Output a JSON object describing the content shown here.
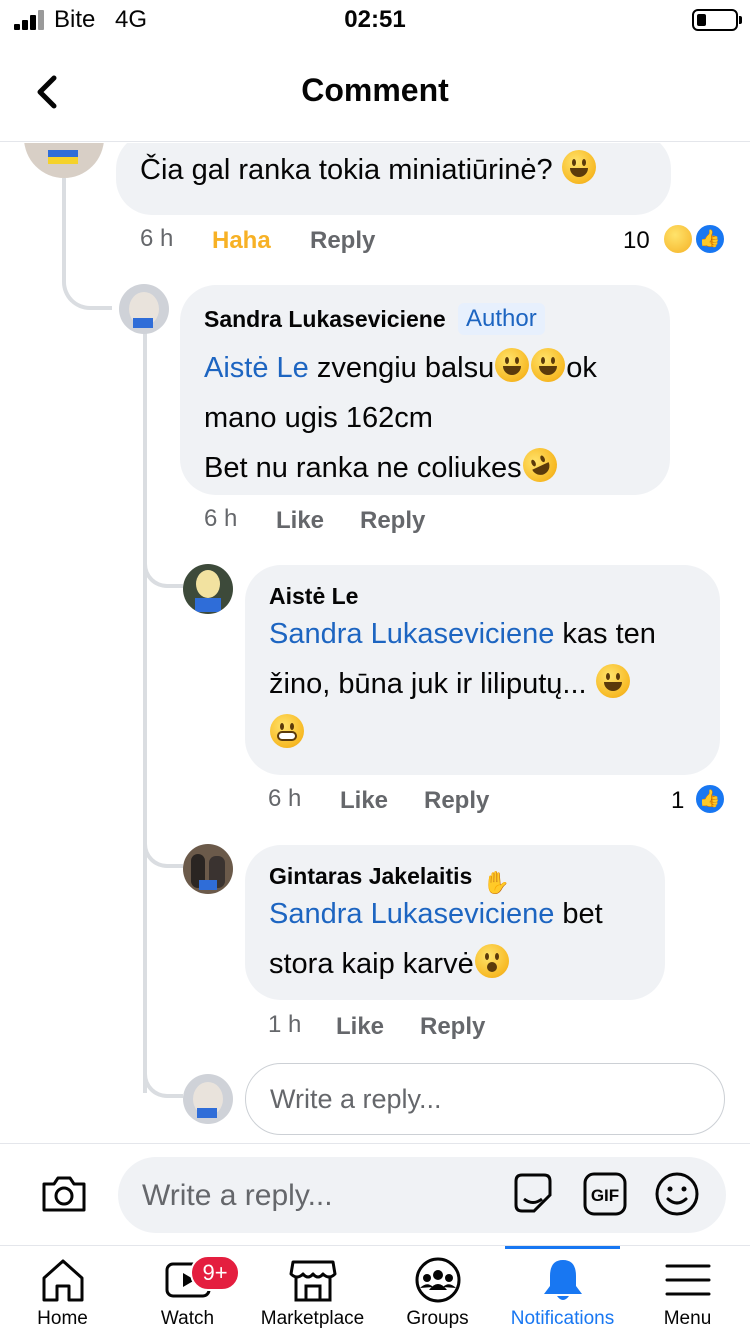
{
  "status_bar": {
    "carrier": "Bite",
    "network": "4G",
    "time": "02:51"
  },
  "header": {
    "title": "Comment"
  },
  "comments": [
    {
      "text": "Čia gal ranka tokia miniatiūrinė?",
      "time": "6 h",
      "reaction_label": "Haha",
      "reply_label": "Reply",
      "reaction_count": "10"
    },
    {
      "author": "Sandra Lukaseviciene",
      "badge": "Author",
      "mention": "Aistė Le",
      "line1": " zvengiu balsu",
      "line1_tail": "ok",
      "line2": "mano ugis 162cm",
      "line3": "Bet nu ranka ne coliukes",
      "time": "6 h",
      "like_label": "Like",
      "reply_label": "Reply"
    },
    {
      "author": "Aistė Le",
      "mention": "Sandra Lukaseviciene",
      "line1": " kas ten",
      "line2": "žino, būna juk ir liliputų...",
      "time": "6 h",
      "like_label": "Like",
      "reply_label": "Reply",
      "reaction_count": "1"
    },
    {
      "author": "Gintaras Jakelaitis",
      "mention": "Sandra Lukaseviciene",
      "line1": " bet",
      "line2": "stora kaip karvė",
      "time": "1 h",
      "like_label": "Like",
      "reply_label": "Reply"
    }
  ],
  "thread_reply": {
    "placeholder": "Write a reply..."
  },
  "compose": {
    "placeholder": "Write a reply...",
    "gif_label": "GIF"
  },
  "tabbar": {
    "tabs": [
      {
        "label": "Home",
        "icon": "home-icon"
      },
      {
        "label": "Watch",
        "icon": "watch-icon",
        "badge": "9+"
      },
      {
        "label": "Marketplace",
        "icon": "marketplace-icon"
      },
      {
        "label": "Groups",
        "icon": "groups-icon"
      },
      {
        "label": "Notifications",
        "icon": "bell-icon",
        "active": true
      },
      {
        "label": "Menu",
        "icon": "menu-icon"
      }
    ]
  },
  "colors": {
    "accent": "#1877f2",
    "mention": "#1d65c1",
    "bubble": "#f0f2f5",
    "haha": "#f7b125",
    "badge": "#e41e3f"
  }
}
